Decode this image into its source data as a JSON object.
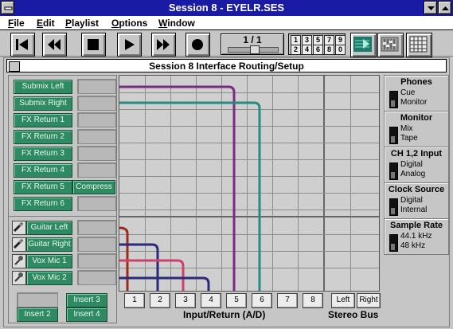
{
  "window": {
    "title": "Session 8 - EYELR.SES"
  },
  "menu": [
    {
      "key": "F",
      "rest": "ile"
    },
    {
      "key": "E",
      "rest": "dit"
    },
    {
      "key": "P",
      "rest": "laylist"
    },
    {
      "key": "O",
      "rest": "ptions"
    },
    {
      "key": "W",
      "rest": "indow"
    }
  ],
  "toolbar": {
    "counter": "1 / 1",
    "track_numbers_top": [
      "1",
      "3",
      "5",
      "7",
      "9"
    ],
    "track_numbers_bottom": [
      "2",
      "4",
      "6",
      "8",
      "0"
    ]
  },
  "inner": {
    "title": "Session 8 Interface Routing/Setup"
  },
  "left": {
    "buses": [
      "Submix Left",
      "Submix Right",
      "FX Return 1",
      "FX Return 2",
      "FX Return 3",
      "FX Return 4",
      "FX Return 5",
      "FX Return 6"
    ],
    "compress": "Compress",
    "inputs": [
      "Guitar Left",
      "Guitar Right",
      "Vox Mic 1",
      "Vox Mic 2"
    ],
    "inserts": [
      "Insert 3",
      "Insert 2",
      "Insert 4"
    ]
  },
  "columns": [
    "1",
    "2",
    "3",
    "4",
    "5",
    "6",
    "7",
    "8"
  ],
  "stereo_cols": [
    "Left",
    "Right"
  ],
  "captions": {
    "input_return": "Input/Return (A/D)",
    "stereo_bus": "Stereo Bus"
  },
  "right": {
    "phones": {
      "title": "Phones",
      "opts": [
        "Cue",
        "Monitor"
      ]
    },
    "monitor": {
      "title": "Monitor",
      "opts": [
        "Mix",
        "Tape"
      ]
    },
    "ch12": {
      "title": "CH 1,2 Input",
      "opts": [
        "Digital",
        "Analog"
      ]
    },
    "clock": {
      "title": "Clock Source",
      "opts": [
        "Digital",
        "Internal"
      ]
    },
    "rate": {
      "title": "Sample Rate",
      "opts": [
        "44.1 kHz",
        "48 kHz"
      ]
    }
  },
  "colors": {
    "accent": "#1a1ba4",
    "route_green": "#2e8a62",
    "wire_purple": "#7b2a86",
    "wire_teal": "#2a8a82",
    "wire_red": "#9c2a1c",
    "wire_navy": "#2a2a7a",
    "wire_pink": "#d0406a"
  }
}
